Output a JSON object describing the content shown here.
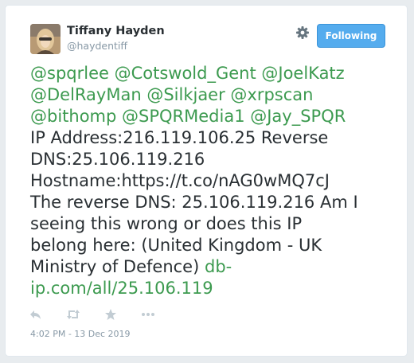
{
  "author": {
    "name": "Tiffany Hayden",
    "handle": "@haydentiff"
  },
  "follow_button": {
    "label": "Following"
  },
  "tweet": {
    "mentions_line1": "@spqrlee @Cotswold_Gent @JoelKatz",
    "mentions_line2": "@DelRayMan @Silkjaer @xrpscan",
    "mentions_line3": "@bithomp @SPQRMedia1 @Jay_SPQR",
    "text_line4": "IP Address:216.119.106.25 Reverse",
    "text_line5": "DNS:25.106.119.216",
    "text_line6": "Hostname:https://t.co/nAG0wMQ7cJ",
    "text_line7": "The reverse DNS: 25.106.119.216 Am I",
    "text_line8": "seeing this wrong or does this IP",
    "text_line9": "belong here: (United Kingdom - UK",
    "text_line10": "Ministry of Defence)",
    "link_part1": "db-",
    "link_part2": "ip.com/all/25.106.119"
  },
  "timestamp": "4:02 PM - 13 Dec 2019",
  "icons": {
    "settings": "gear-icon",
    "reply": "reply-icon",
    "retweet": "retweet-icon",
    "like": "star-icon",
    "more": "more-icon"
  },
  "colors": {
    "link": "#3c9a4f",
    "follow_button": "#55acee",
    "text": "#292f33",
    "muted": "#8899a6"
  }
}
